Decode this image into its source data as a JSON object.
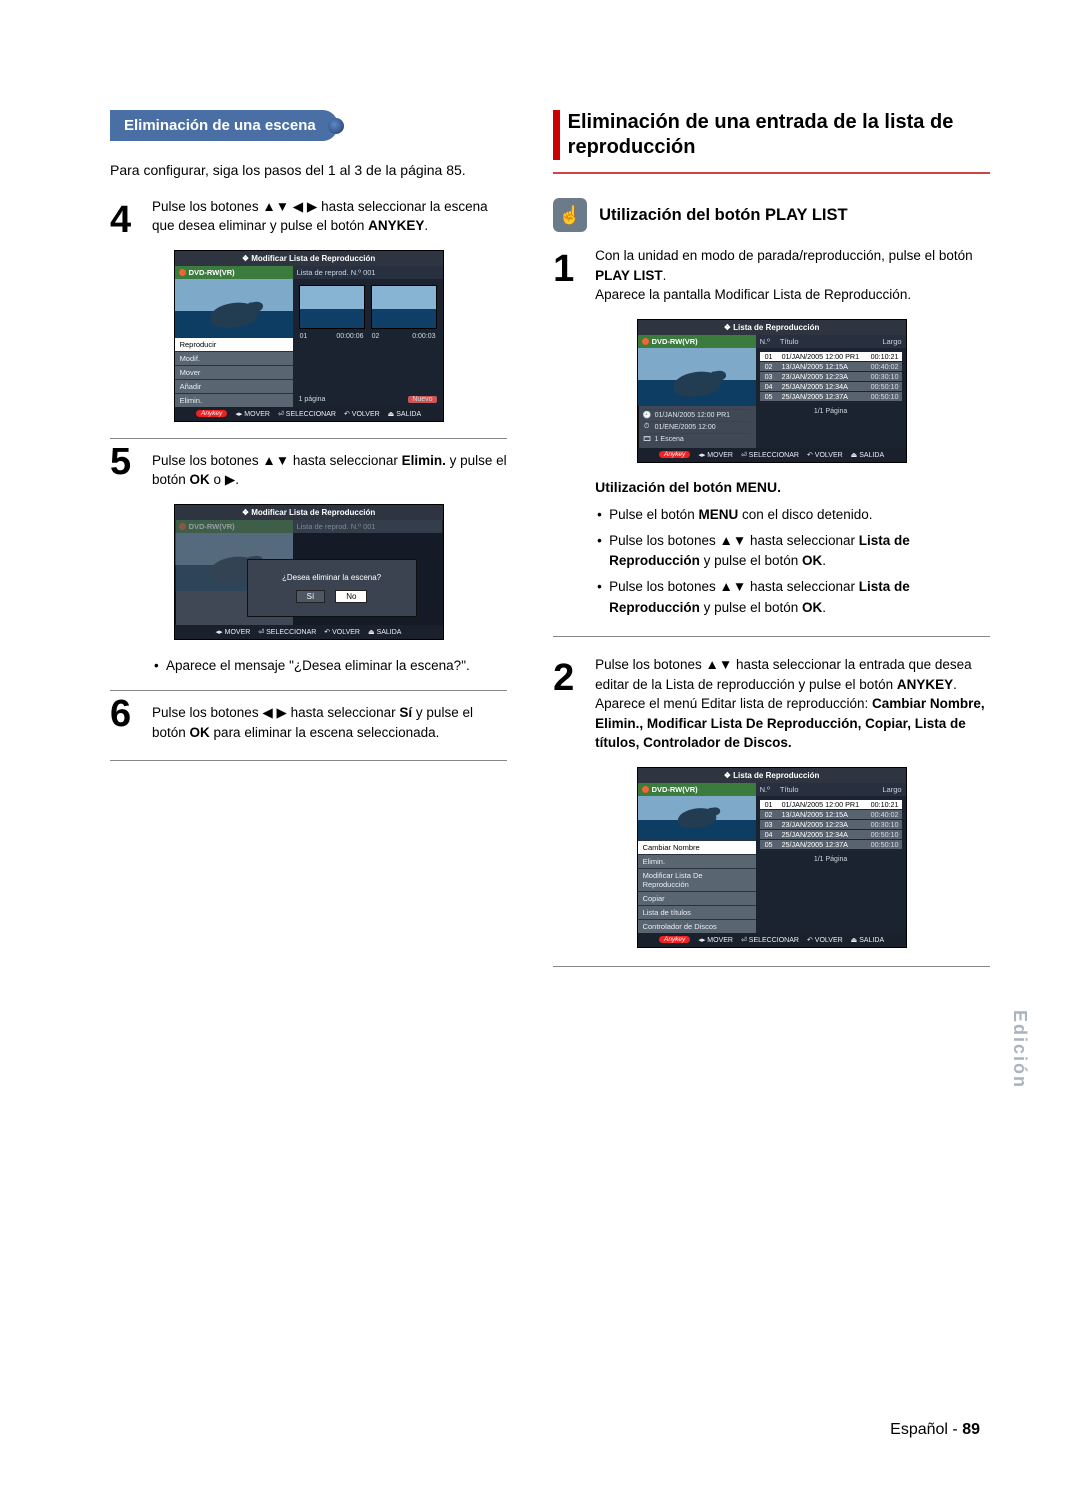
{
  "left": {
    "pill": "Eliminación de una escena",
    "intro": "Para configurar, siga los pasos del 1 al 3 de la página 85.",
    "step4": {
      "num": "4",
      "text_a": "Pulse los botones ",
      "arrows4": "▲▼ ◀ ▶",
      "text_b": " hasta seleccionar la escena que desea eliminar y pulse el botón ",
      "anykey": "ANYKEY",
      "text_c": "."
    },
    "osd1": {
      "title": "Modificar Lista de Reproducción",
      "hdr_left": "DVD-RW(VR)",
      "hdr_right": "Lista de reprod. N.º 001",
      "menu": [
        "Reproducir",
        "Modif.",
        "Mover",
        "Añadir",
        "Elimin."
      ],
      "thumb1_n": "01",
      "thumb1_t": "00:00:06",
      "thumb2_n": "02",
      "thumb2_t": "0:00:03",
      "pager": "1 página",
      "nuevo": "Nuevo",
      "footer": {
        "anykey": "Anykey",
        "mover": "MOVER",
        "sel": "SELECCIONAR",
        "vol": "VOLVER",
        "sal": "SALIDA"
      }
    },
    "step5": {
      "num": "5",
      "text_a": "Pulse los botones ",
      "arrows2": "▲▼",
      "text_b": " hasta seleccionar ",
      "elim": "Elimin.",
      "text_c": " y pulse el botón ",
      "ok": "OK",
      "text_d": " o ",
      "play": "▶",
      "text_e": "."
    },
    "osd2": {
      "title": "Modificar Lista de Reproducción",
      "hdr_left": "DVD-RW(VR)",
      "hdr_right": "Lista de reprod. N.º 001",
      "question": "¿Desea eliminar la escena?",
      "yes": "Sí",
      "no": "No",
      "footer": {
        "mover": "MOVER",
        "sel": "SELECCIONAR",
        "vol": "VOLVER",
        "sal": "SALIDA"
      }
    },
    "bullet1": "Aparece el mensaje \"¿Desea eliminar la escena?\".",
    "step6": {
      "num": "6",
      "text_a": "Pulse los botones ",
      "arrowsLR": "◀ ▶",
      "text_b": " hasta seleccionar ",
      "si": "Sí",
      "text_c": " y pulse el botón ",
      "ok": "OK",
      "text_d": " para eliminar la escena seleccionada."
    }
  },
  "right": {
    "heading": "Eliminación de una entrada de la lista de reproducción",
    "sub": "Utilización del botón PLAY LIST",
    "step1": {
      "num": "1",
      "text_a": "Con la unidad en modo de parada/reproducción, pulse el botón ",
      "pl": "PLAY LIST",
      "text_b": ".",
      "text_c": "Aparece la pantalla Modificar Lista de Reproducción."
    },
    "osd3": {
      "title": "Lista de Reproducción",
      "hdr_left": "DVD-RW(VR)",
      "cols": {
        "n": "N.º",
        "t": "Título",
        "l": "Largo"
      },
      "rows": [
        {
          "n": "01",
          "t": "01/JAN/2005 12:00 PR1",
          "l": "00:10:21",
          "sel": true
        },
        {
          "n": "02",
          "t": "13/JAN/2005 12:15A",
          "l": "00:40:02"
        },
        {
          "n": "03",
          "t": "23/JAN/2005 12:23A",
          "l": "00:30:10"
        },
        {
          "n": "04",
          "t": "25/JAN/2005 12:34A",
          "l": "00:50:10"
        },
        {
          "n": "05",
          "t": "25/JAN/2005 12:37A",
          "l": "00:50:10"
        }
      ],
      "info": [
        "01/JAN/2005 12:00 PR1",
        "01/ENE/2005 12:00",
        "1 Escena"
      ],
      "pager": "1/1 Página",
      "footer": {
        "anykey": "Anykey",
        "mover": "MOVER",
        "sel": "SELECCIONAR",
        "vol": "VOLVER",
        "sal": "SALIDA"
      }
    },
    "menu_sub": "Utilización del botón MENU.",
    "mbul1_a": "Pulse el botón ",
    "mbul1_b": "MENU",
    "mbul1_c": " con el disco detenido.",
    "mbul2_a": "Pulse los botones ",
    "mbul2_arrows": "▲▼",
    "mbul2_b": " hasta seleccionar ",
    "mbul2_c": "Lista de Reproducción",
    "mbul2_d": " y pulse el botón ",
    "mbul2_e": "OK",
    "mbul2_f": ".",
    "mbul3_a": "Pulse los botones ",
    "mbul3_arrows": "▲▼",
    "mbul3_b": " hasta seleccionar ",
    "mbul3_c": "Lista de Reproducción",
    "mbul3_d": " y pulse el botón ",
    "mbul3_e": "OK",
    "mbul3_f": ".",
    "step2": {
      "num": "2",
      "text_a": "Pulse los botones ",
      "arrows2": "▲▼",
      "text_b": " hasta seleccionar la entrada que desea editar de la Lista de reproducción y pulse el botón ",
      "anykey": "ANYKEY",
      "text_c": ".",
      "text_d": "Aparece el menú Editar lista de reproducción: ",
      "bold_list": "Cambiar Nombre, Elimin., Modificar Lista De Reproducción, Copiar, Lista de títulos, Controlador de Discos."
    },
    "osd4": {
      "title": "Lista de Reproducción",
      "hdr_left": "DVD-RW(VR)",
      "cols": {
        "n": "N.º",
        "t": "Título",
        "l": "Largo"
      },
      "menu": [
        "Cambiar Nombre",
        "Elimin.",
        "Modificar Lista De Reproducción",
        "Copiar",
        "Lista de títulos",
        "Controlador de Discos"
      ],
      "rows": [
        {
          "n": "01",
          "t": "01/JAN/2005 12:00 PR1",
          "l": "00:10:21",
          "sel": true
        },
        {
          "n": "02",
          "t": "13/JAN/2005 12:15A",
          "l": "00:40:02"
        },
        {
          "n": "03",
          "t": "23/JAN/2005 12:23A",
          "l": "00:30:10"
        },
        {
          "n": "04",
          "t": "25/JAN/2005 12:34A",
          "l": "00:50:10"
        },
        {
          "n": "05",
          "t": "25/JAN/2005 12:37A",
          "l": "00:50:10"
        }
      ],
      "pager": "1/1 Página",
      "footer": {
        "anykey": "Anykey",
        "mover": "MOVER",
        "sel": "SELECCIONAR",
        "vol": "VOLVER",
        "sal": "SALIDA"
      }
    }
  },
  "side_tab": "Edición",
  "footer_lang": "Español - ",
  "footer_page": "89"
}
